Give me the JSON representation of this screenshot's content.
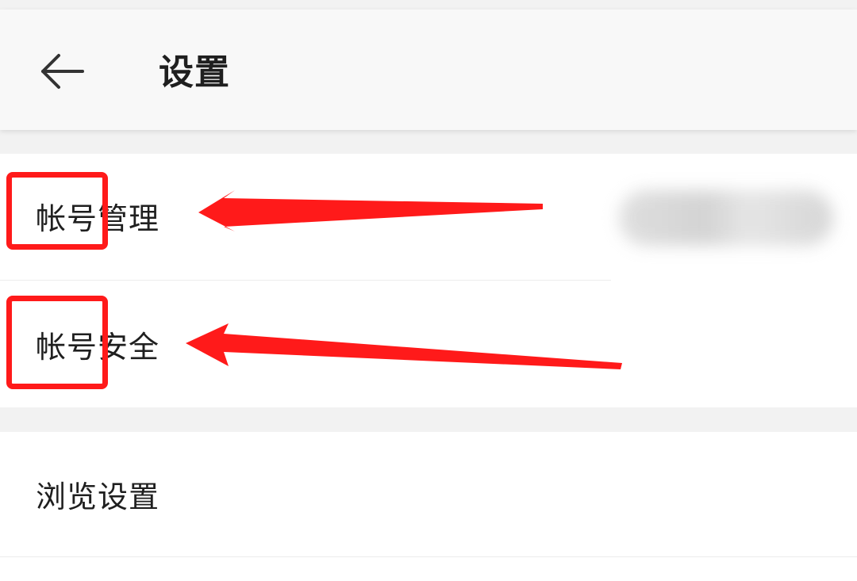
{
  "header": {
    "back_icon": "arrow-left-icon",
    "title": "设置"
  },
  "settings": {
    "account_management": "帐号管理",
    "account_security": "帐号安全",
    "browse_settings": "浏览设置"
  },
  "colors": {
    "annotation_red": "#ff1a1a",
    "text_primary": "#1f1f1f",
    "background": "#f2f2f2"
  }
}
